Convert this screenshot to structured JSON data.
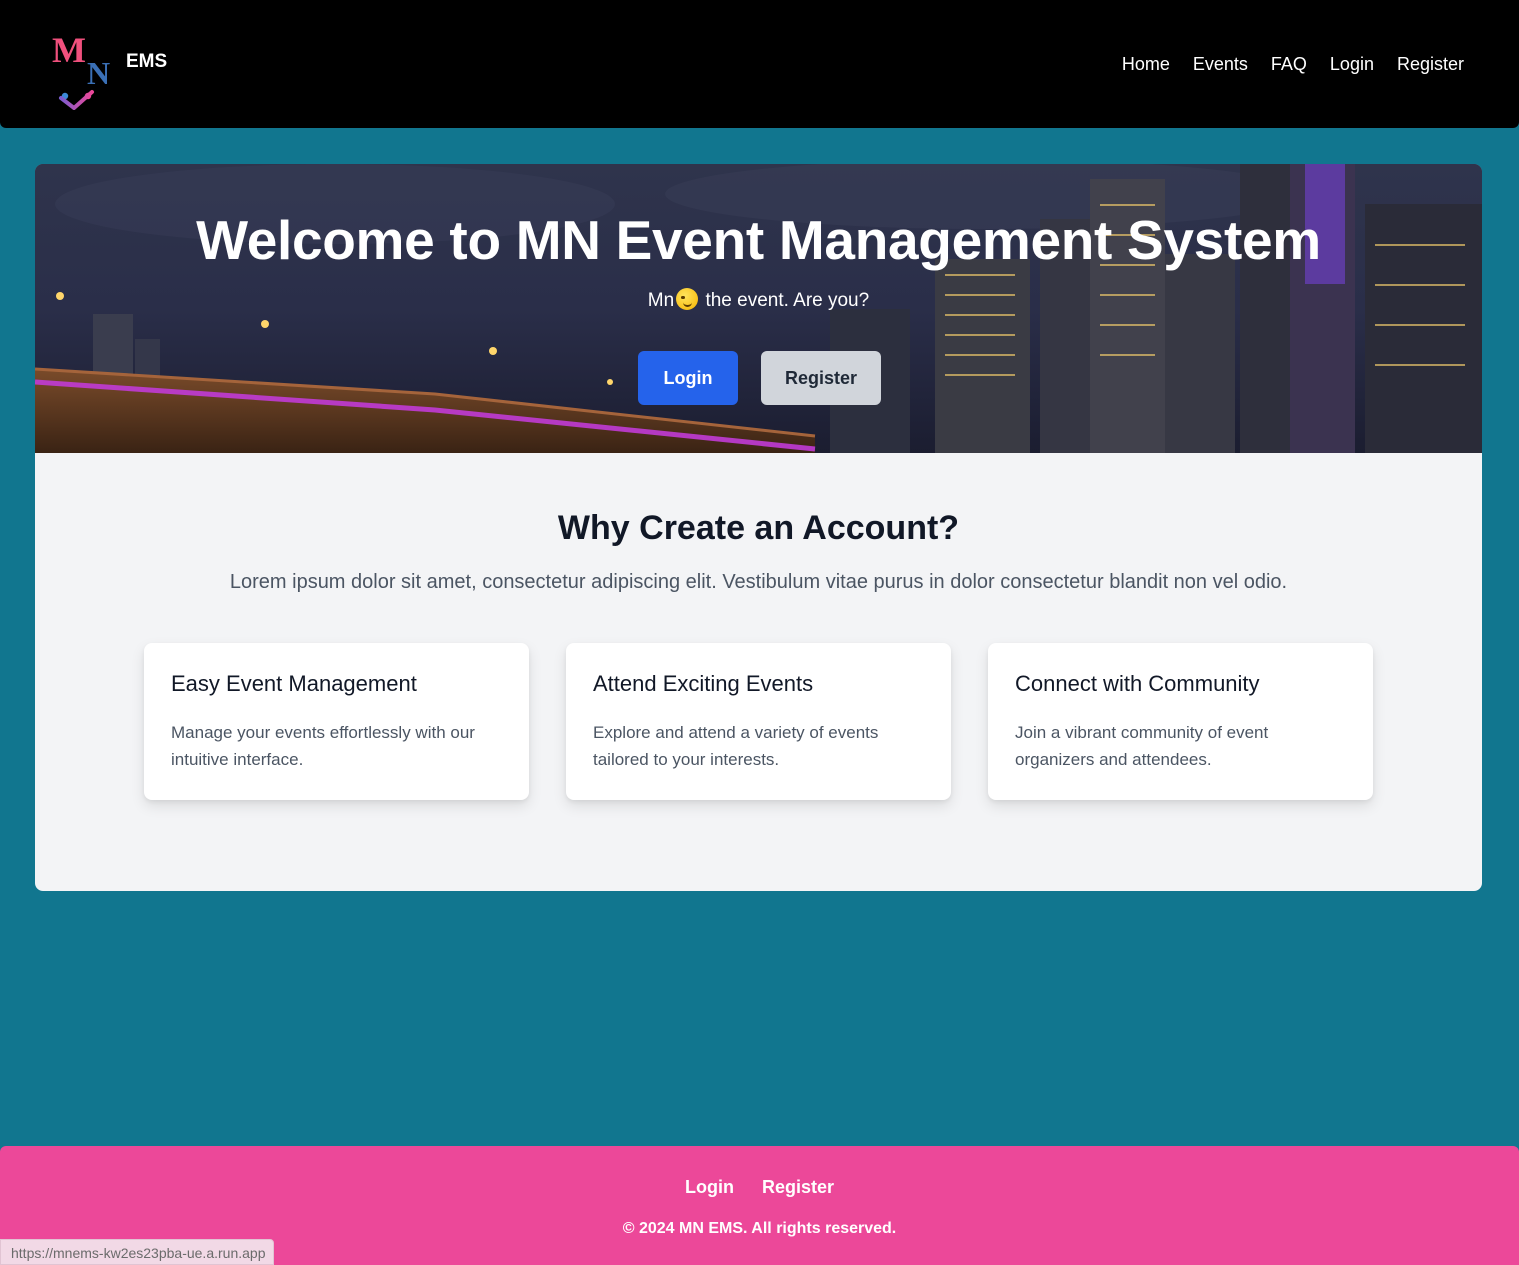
{
  "navbar": {
    "brand": "EMS",
    "logo_letters": [
      "M",
      "N"
    ],
    "links": [
      "Home",
      "Events",
      "FAQ",
      "Login",
      "Register"
    ]
  },
  "hero": {
    "title": "Welcome to MN Event Management System",
    "subtitle_prefix": "Mn",
    "subtitle_emoji": "smirking-face-emoji",
    "subtitle_suffix": " the event. Are you?",
    "login_label": "Login",
    "register_label": "Register"
  },
  "why": {
    "title": "Why Create an Account?",
    "description": "Lorem ipsum dolor sit amet, consectetur adipiscing elit. Vestibulum vitae purus in dolor consectetur blandit non vel odio."
  },
  "features": [
    {
      "title": "Easy Event Management",
      "text": "Manage your events effortlessly with our intuitive interface."
    },
    {
      "title": "Attend Exciting Events",
      "text": "Explore and attend a variety of events tailored to your interests."
    },
    {
      "title": "Connect with Community",
      "text": "Join a vibrant community of event organizers and attendees."
    }
  ],
  "footer": {
    "login": "Login",
    "register": "Register",
    "copyright": "© 2024 MN EMS. All rights reserved."
  },
  "status_bar": {
    "url": "https://mnems-kw2es23pba-ue.a.run.app"
  },
  "colors": {
    "page_bg": "#11768f",
    "navbar_bg": "#000000",
    "footer_bg": "#ec4899",
    "primary_button": "#2563eb",
    "secondary_button": "#d1d5db"
  }
}
